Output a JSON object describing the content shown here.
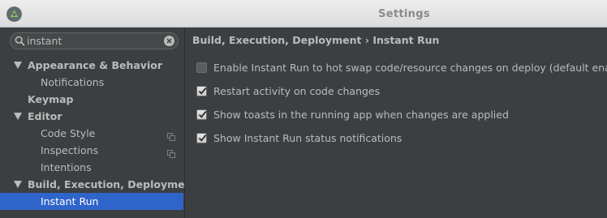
{
  "window": {
    "title": "Settings"
  },
  "search": {
    "value": "instant"
  },
  "sidebar": {
    "items": [
      {
        "label": "Appearance & Behavior",
        "expanded": true,
        "bold": true
      },
      {
        "label": "Notifications"
      },
      {
        "label": "Keymap",
        "bold": true
      },
      {
        "label": "Editor",
        "expanded": true,
        "bold": true
      },
      {
        "label": "Code Style",
        "has_copy_icon": true
      },
      {
        "label": "Inspections",
        "has_copy_icon": true
      },
      {
        "label": "Intentions"
      },
      {
        "label": "Build, Execution, Deployment",
        "expanded": true,
        "bold": true
      },
      {
        "label": "Instant Run",
        "selected": true
      }
    ]
  },
  "main": {
    "breadcrumb": "Build, Execution, Deployment › Instant Run",
    "options": [
      {
        "label": "Enable Instant Run to hot swap code/resource changes on deploy (default enabled)",
        "checked": false
      },
      {
        "label": "Restart activity on code changes",
        "checked": true
      },
      {
        "label": "Show toasts in the running app when changes are applied",
        "checked": true
      },
      {
        "label": "Show Instant Run status notifications",
        "checked": true
      }
    ]
  },
  "colors": {
    "background": "#3c3f41",
    "selection": "#2f65ca",
    "text": "#bbbbbb",
    "titlebar": "#e4e4e4"
  }
}
